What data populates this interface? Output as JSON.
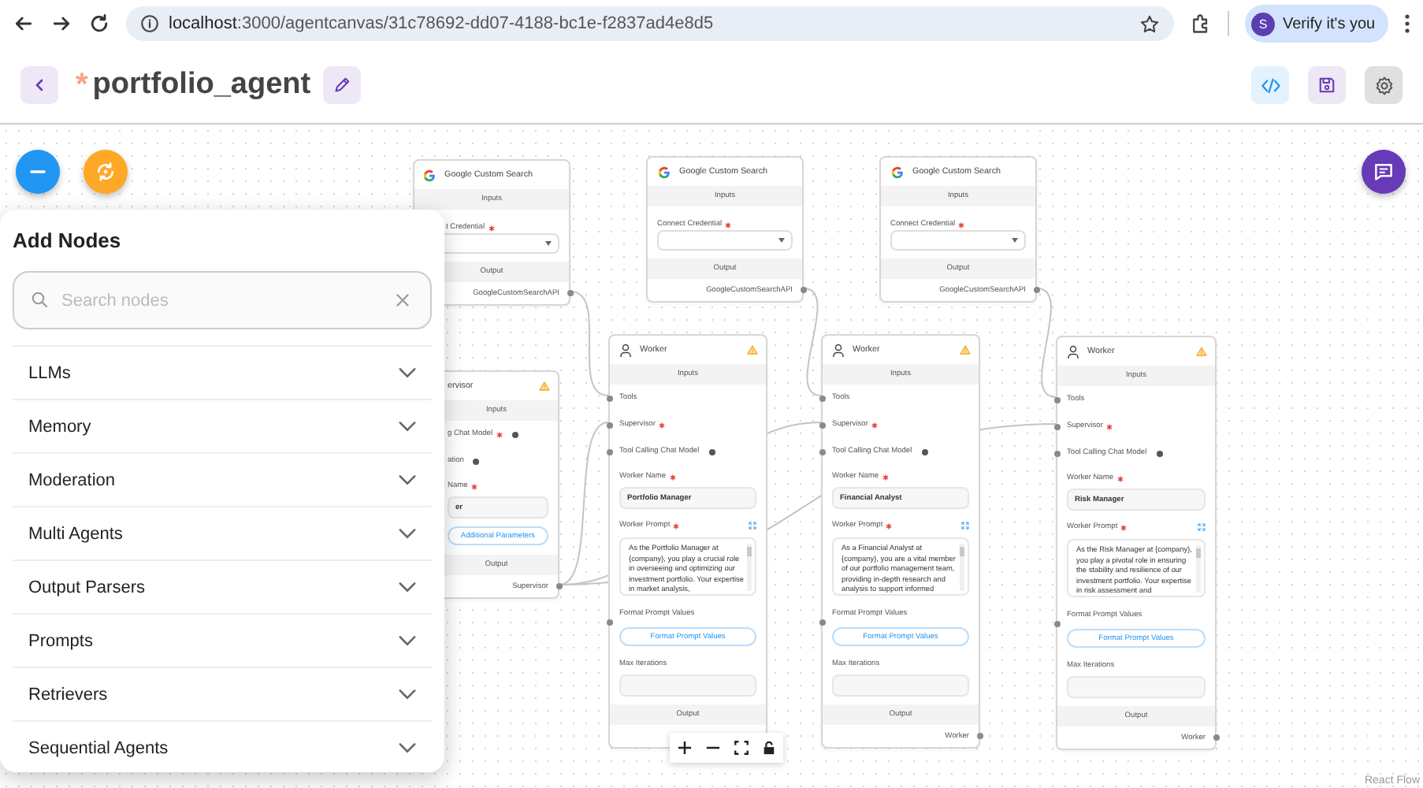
{
  "browser": {
    "url_host": "localhost",
    "url_path": ":3000/agentcanvas/31c78692-dd07-4188-bc1e-f2837ad4e8d5",
    "profile_initial": "S",
    "profile_label": "Verify it's you"
  },
  "header": {
    "unsaved_mark": "*",
    "title": "portfolio_agent"
  },
  "canvas": {
    "nodes": [
      {
        "kind": "tool",
        "title": "Google Custom Search",
        "inputs_label": "Inputs",
        "credential": {
          "label": "t Credential",
          "required": true
        },
        "output_label": "Output",
        "output": "GoogleCustomSearchAPI"
      },
      {
        "kind": "tool",
        "title": "Google Custom Search",
        "inputs_label": "Inputs",
        "credential": {
          "label": "Connect Credential",
          "required": true
        },
        "output_label": "Output",
        "output": "GoogleCustomSearchAPI"
      },
      {
        "kind": "tool",
        "title": "Google Custom Search",
        "inputs_label": "Inputs",
        "credential": {
          "label": "Connect Credential",
          "required": true
        },
        "output_label": "Output",
        "output": "GoogleCustomSearchAPI"
      },
      {
        "kind": "supervisor",
        "title": "ervisor",
        "warning": true,
        "inputs_label": "Inputs",
        "handles": [
          {
            "label": "g Chat Model",
            "required": true,
            "info": true
          },
          {
            "label": "ation",
            "required": false,
            "info": true
          }
        ],
        "fields": [
          {
            "kind": "text",
            "label": "Name",
            "required": true,
            "value": "er"
          },
          {
            "kind": "params",
            "button": "Additional Parameters"
          }
        ],
        "output_label": "Output",
        "output": "Supervisor"
      },
      {
        "kind": "worker",
        "title": "Worker",
        "warning": true,
        "inputs_label": "Inputs",
        "handles": [
          {
            "label": "Tools",
            "required": false,
            "info": false
          },
          {
            "label": "Supervisor",
            "required": true,
            "info": false
          },
          {
            "label": "Tool Calling Chat Model",
            "required": false,
            "info": true
          }
        ],
        "fields": [
          {
            "kind": "text",
            "label": "Worker Name",
            "required": true,
            "value": "Portfolio Manager"
          },
          {
            "kind": "textarea",
            "label": "Worker Prompt",
            "required": true,
            "expandable": true,
            "value": "As the Portfolio Manager at {company}, you play a crucial role in overseeing and optimizing our investment portfolio. Your expertise in market analysis,"
          },
          {
            "kind": "button",
            "label": "Format Prompt Values",
            "button": "Format Prompt Values"
          },
          {
            "kind": "text",
            "label": "Max Iterations"
          }
        ],
        "output_label": "Output"
      },
      {
        "kind": "worker",
        "title": "Worker",
        "warning": true,
        "inputs_label": "Inputs",
        "handles": [
          {
            "label": "Tools",
            "required": false,
            "info": false
          },
          {
            "label": "Supervisor",
            "required": true,
            "info": false
          },
          {
            "label": "Tool Calling Chat Model",
            "required": false,
            "info": true
          }
        ],
        "fields": [
          {
            "kind": "text",
            "label": "Worker Name",
            "required": true,
            "value": "Financial Analyst"
          },
          {
            "kind": "textarea",
            "label": "Worker Prompt",
            "required": true,
            "expandable": true,
            "value": "As a Financial Analyst at {company}, you are a vital member of our portfolio management team, providing in-depth research and analysis to support informed"
          },
          {
            "kind": "button",
            "label": "Format Prompt Values",
            "button": "Format Prompt Values"
          },
          {
            "kind": "text",
            "label": "Max Iterations"
          }
        ],
        "output_label": "Output",
        "output": "Worker"
      },
      {
        "kind": "worker",
        "title": "Worker",
        "warning": true,
        "inputs_label": "Inputs",
        "handles": [
          {
            "label": "Tools",
            "required": false,
            "info": false
          },
          {
            "label": "Supervisor",
            "required": true,
            "info": false
          },
          {
            "label": "Tool Calling Chat Model",
            "required": false,
            "info": true
          }
        ],
        "fields": [
          {
            "kind": "text",
            "label": "Worker Name",
            "required": true,
            "value": "Risk Manager"
          },
          {
            "kind": "textarea",
            "label": "Worker Prompt",
            "required": true,
            "expandable": true,
            "value": "As the Risk Manager at {company}, you play a pivotal role in ensuring the stability and resilience of our investment portfolio. Your expertise in risk assessment and"
          },
          {
            "kind": "button",
            "label": "Format Prompt Values",
            "button": "Format Prompt Values"
          },
          {
            "kind": "text",
            "label": "Max Iterations"
          }
        ],
        "output_label": "Output",
        "output": "Worker"
      }
    ],
    "attribution": "React Flow"
  },
  "add_nodes": {
    "title": "Add Nodes",
    "search": {
      "placeholder": "Search nodes"
    },
    "categories": [
      {
        "label": "LLMs",
        "expanded": false
      },
      {
        "label": "Memory",
        "expanded": false
      },
      {
        "label": "Moderation",
        "expanded": false
      },
      {
        "label": "Multi Agents",
        "expanded": false
      },
      {
        "label": "Output Parsers",
        "expanded": false
      },
      {
        "label": "Prompts",
        "expanded": false
      },
      {
        "label": "Retrievers",
        "expanded": false
      },
      {
        "label": "Sequential Agents",
        "expanded": false
      }
    ]
  }
}
